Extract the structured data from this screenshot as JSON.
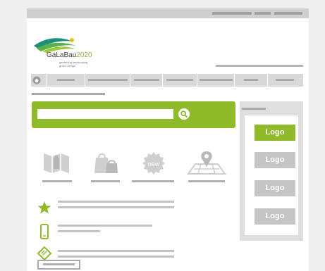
{
  "brand": {
    "name": "GaLaBau",
    "year": "2020",
    "tagline_1": "gardening landscaping",
    "tagline_2": "green design",
    "logo_icon": "galabau-wave-logo",
    "green": "#8fbb2a"
  },
  "nav": {
    "home_icon": "home-icon",
    "items": [
      "",
      "",
      "",
      "",
      "",
      "",
      ""
    ]
  },
  "search": {
    "placeholder": "",
    "button_icon": "search-icon"
  },
  "features": [
    {
      "icon": "map-booth-icon"
    },
    {
      "icon": "shopping-bags-icon"
    },
    {
      "icon": "new-badge-icon",
      "badge_text": "new"
    },
    {
      "icon": "location-pin-map-icon"
    }
  ],
  "list_icons": [
    "star-icon",
    "mobile-phone-icon",
    "ticket-icon"
  ],
  "sidebar": {
    "logos": [
      {
        "label": "Logo",
        "active": true
      },
      {
        "label": "Logo",
        "active": false
      },
      {
        "label": "Logo",
        "active": false
      },
      {
        "label": "Logo",
        "active": false
      }
    ]
  }
}
